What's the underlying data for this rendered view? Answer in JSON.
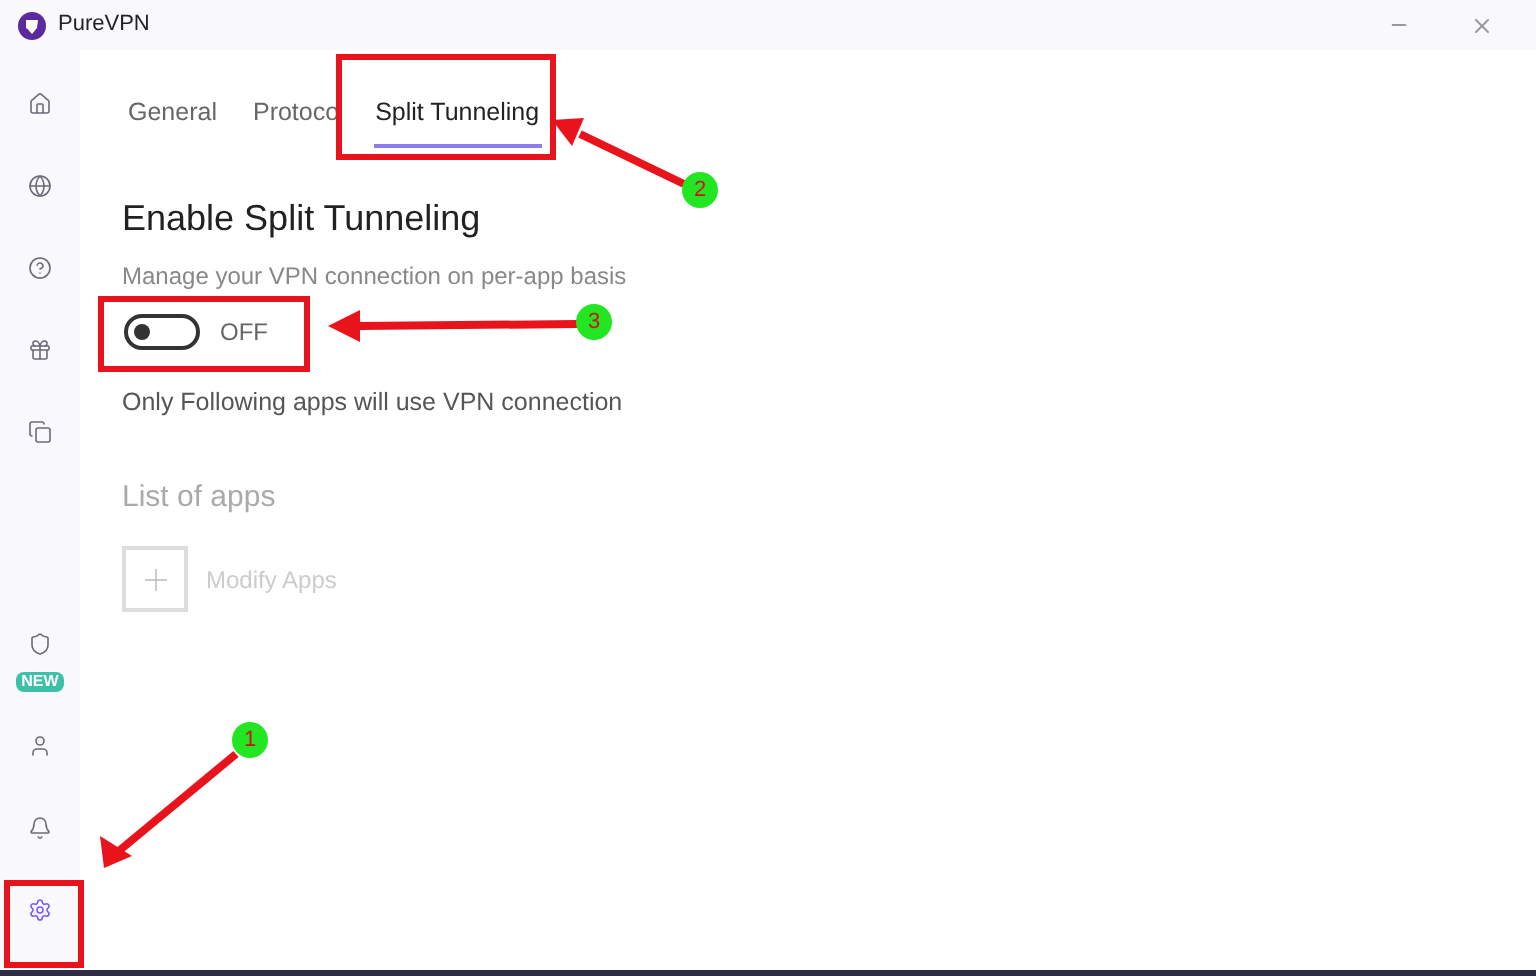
{
  "window": {
    "title": "PureVPN"
  },
  "sidebar": {
    "items": [
      {
        "kind": "home",
        "selected": false
      },
      {
        "kind": "globe",
        "selected": false
      },
      {
        "kind": "help",
        "selected": false
      },
      {
        "kind": "gift",
        "selected": false
      },
      {
        "kind": "devices",
        "selected": false
      },
      {
        "kind": "shield",
        "selected": false,
        "badge": "NEW"
      },
      {
        "kind": "user",
        "selected": false
      },
      {
        "kind": "bell",
        "selected": false
      },
      {
        "kind": "settings",
        "selected": true
      }
    ]
  },
  "tabs": [
    {
      "label": "General",
      "selected": false
    },
    {
      "label": "Protoco",
      "selected": false
    },
    {
      "label": "Split Tunneling",
      "selected": true
    }
  ],
  "split_tunneling": {
    "heading": "Enable Split Tunneling",
    "description": "Manage your VPN connection on per-app basis",
    "toggle": {
      "on": false,
      "label": "OFF"
    },
    "note": "Only Following apps will use VPN connection",
    "list_heading": "List of apps",
    "modify_button": "Modify Apps"
  },
  "annotations": [
    {
      "number": "1",
      "kind": "settings"
    },
    {
      "number": "2",
      "kind": "tab"
    },
    {
      "number": "3",
      "kind": "toggle"
    }
  ]
}
